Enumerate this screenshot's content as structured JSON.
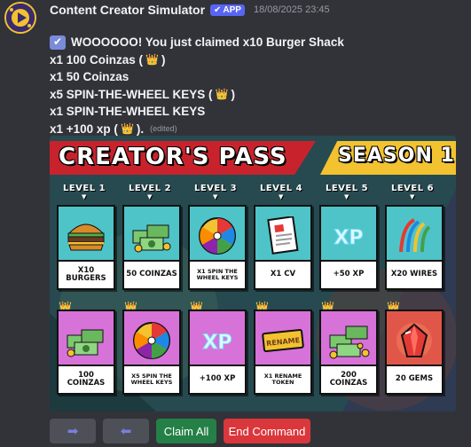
{
  "header": {
    "username": "Content Creator Simulator",
    "badge": "APP",
    "timestamp": "18/08/2025 23:45"
  },
  "message": {
    "lines": [
      "WOOOOOO! You just claimed x10 Burger Shack",
      "x1 100 Coinzas (",
      "x1 50 Coinzas",
      "x5 SPIN-THE-WHEEL KEYS (",
      "x1 SPIN-THE-WHEEL KEYS",
      "x1 +100 xp ("
    ],
    "closers": [
      ")",
      ")",
      ")."
    ],
    "edited": "(edited)"
  },
  "pass": {
    "title": "CREATOR'S PASS",
    "season": "SEASON 1",
    "levels": [
      "LEVEL 1",
      "LEVEL 2",
      "LEVEL 3",
      "LEVEL 4",
      "LEVEL 5",
      "LEVEL 6"
    ],
    "free_row": [
      {
        "label": "X10 BURGERS",
        "icon": "burger-icon"
      },
      {
        "label": "50 COINZAS",
        "icon": "money-stack-icon"
      },
      {
        "label": "X1 SPIN THE WHEEL KEYS",
        "icon": "spin-wheel-icon"
      },
      {
        "label": "X1 CV",
        "icon": "cv-document-icon"
      },
      {
        "label": "+50 XP",
        "icon": "xp-icon"
      },
      {
        "label": "X20 WIRES",
        "icon": "wires-icon"
      }
    ],
    "premium_row": [
      {
        "label": "100 COINZAS",
        "icon": "money-stack-icon"
      },
      {
        "label": "X5 SPIN THE WHEEL KEYS",
        "icon": "spin-wheel-icon"
      },
      {
        "label": "+100 XP",
        "icon": "xp-icon"
      },
      {
        "label": "X1 RENAME TOKEN",
        "icon": "rename-token-icon"
      },
      {
        "label": "200 COINZAS",
        "icon": "money-stack-icon"
      },
      {
        "label": "20 GEMS",
        "icon": "gem-icon"
      }
    ],
    "rename_word": "RENAME"
  },
  "buttons": {
    "next": "➡",
    "prev": "⬅",
    "claim_all": "Claim All",
    "end_command": "End Command"
  },
  "colors": {
    "background": "#323339",
    "teal_card": "#4ec4c8",
    "pink_card": "#d772d9",
    "claim_green": "#248046",
    "end_red": "#da373c",
    "banner_red": "#c8232c",
    "banner_yellow": "#f2c230"
  }
}
